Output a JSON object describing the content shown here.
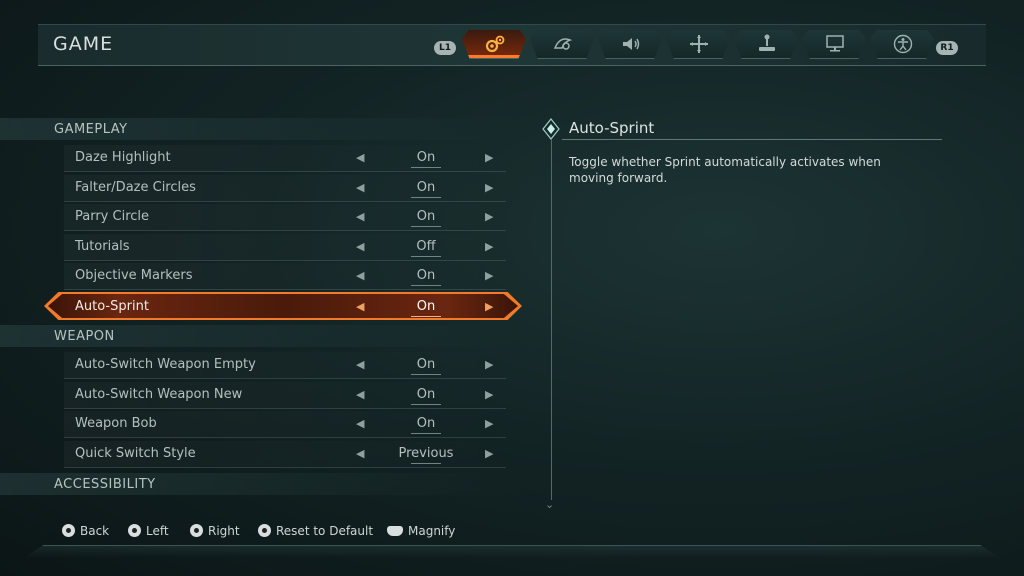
{
  "header": {
    "title": "GAME",
    "left_bumper": "L1",
    "right_bumper": "R1",
    "tabs": [
      {
        "icon": "gears-icon",
        "active": true
      },
      {
        "icon": "controller-swirl-icon",
        "active": false
      },
      {
        "icon": "speaker-icon",
        "active": false
      },
      {
        "icon": "crosshair-icon",
        "active": false
      },
      {
        "icon": "joystick-icon",
        "active": false
      },
      {
        "icon": "monitor-icon",
        "active": false
      },
      {
        "icon": "accessibility-icon",
        "active": false
      }
    ]
  },
  "sections": {
    "gameplay": "GAMEPLAY",
    "weapon": "WEAPON",
    "accessibility": "ACCESSIBILITY"
  },
  "settings": [
    {
      "label": "Daze Highlight",
      "value": "On"
    },
    {
      "label": "Falter/Daze Circles",
      "value": "On"
    },
    {
      "label": "Parry Circle",
      "value": "On"
    },
    {
      "label": "Tutorials",
      "value": "Off"
    },
    {
      "label": "Objective Markers",
      "value": "On"
    },
    {
      "label": "Auto-Sprint",
      "value": "On",
      "selected": true
    },
    {
      "label": "Auto-Switch Weapon Empty",
      "value": "On"
    },
    {
      "label": "Auto-Switch Weapon New",
      "value": "On"
    },
    {
      "label": "Weapon Bob",
      "value": "On"
    },
    {
      "label": "Quick Switch Style",
      "value": "Previous"
    }
  ],
  "description": {
    "title": "Auto-Sprint",
    "text": "Toggle whether Sprint automatically activates when moving forward."
  },
  "footer": {
    "back": "Back",
    "left": "Left",
    "right": "Right",
    "reset": "Reset to Default",
    "magnify": "Magnify"
  },
  "colors": {
    "accent": "#f27a2a",
    "background": "#132425",
    "text": "#c9d3d2"
  }
}
